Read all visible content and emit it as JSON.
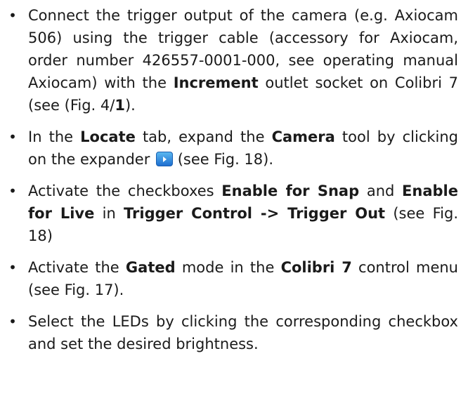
{
  "bullet_glyph": "•",
  "items": [
    {
      "t1": "Connect the trigger output of the camera (e.g. Axiocam 506) using the trigger cable (accessory for Axiocam, order number 426557-0001-000, see operating manual Axiocam) with the ",
      "b1": "Increment",
      "t2": " outlet socket on Colibri 7 (see (Fig. 4/",
      "b2": "1",
      "t3": ")."
    },
    {
      "t1": "In the ",
      "b1": "Locate",
      "t2": " tab, expand the ",
      "b2": "Camera",
      "t3": " tool by clicking on the expander ",
      "t4": " (see Fig. 18).",
      "icon": "expander-icon"
    },
    {
      "t1": "Activate the checkboxes ",
      "b1": "Enable for Snap",
      "t2": " and ",
      "b2": "Enable for Live",
      "t3": " in ",
      "b3": "Trigger Control -> Trigger Out",
      "t4": " (see Fig. 18)"
    },
    {
      "t1": "Activate the ",
      "b1": "Gated",
      "t2": " mode in the ",
      "b2": "Colibri 7",
      "t3": " control menu (see Fig. 17)."
    },
    {
      "t1": "Select the LEDs by clicking the corresponding checkbox and set the desired brightness."
    }
  ]
}
